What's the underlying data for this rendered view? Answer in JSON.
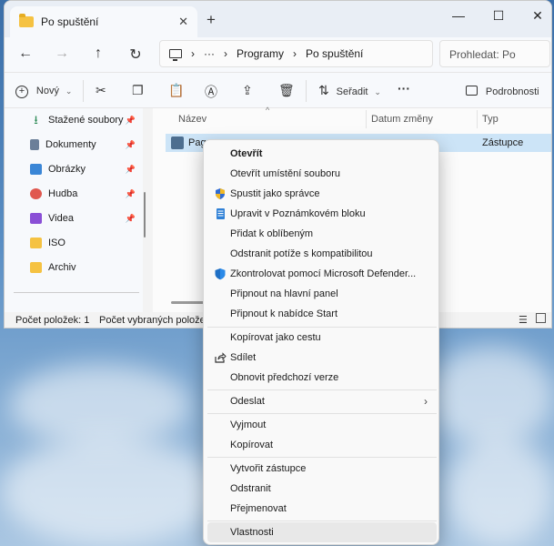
{
  "window": {
    "tab_title": "Po spuštění",
    "tab_close": "✕",
    "new_tab": "+",
    "minimize": "—",
    "maximize": "☐",
    "close": "✕"
  },
  "nav": {
    "back": "←",
    "forward": "→",
    "up": "↑",
    "refresh": "↻",
    "breadcrumb": [
      "›",
      "···",
      "›",
      "Programy",
      "›",
      "Po spuštění"
    ],
    "search_placeholder": "Prohledat: Po"
  },
  "toolbar": {
    "new_label": "Nový",
    "sort_label": "Seřadit",
    "more": "···",
    "details_label": "Podrobnosti"
  },
  "sidebar": {
    "items": [
      {
        "label": "Stažené soubory",
        "icon": "download-icon",
        "pinned": true,
        "color": "#2e8b57"
      },
      {
        "label": "Dokumenty",
        "icon": "documents-icon",
        "pinned": true,
        "color": "#6b7f99"
      },
      {
        "label": "Obrázky",
        "icon": "pictures-icon",
        "pinned": true,
        "color": "#3a86d6"
      },
      {
        "label": "Hudba",
        "icon": "music-icon",
        "pinned": true,
        "color": "#e0584f"
      },
      {
        "label": "Videa",
        "icon": "videos-icon",
        "pinned": true,
        "color": "#8a4fd6"
      },
      {
        "label": "ISO",
        "icon": "folder-icon",
        "pinned": false,
        "color": "#f5c242"
      },
      {
        "label": "Archiv",
        "icon": "folder-icon",
        "pinned": false,
        "color": "#f5c242"
      }
    ]
  },
  "content": {
    "columns": [
      "Název",
      "Datum změny",
      "Typ"
    ],
    "selected_row": {
      "name": "Page",
      "type": "Zástupce"
    }
  },
  "status": {
    "count": "Počet položek: 1",
    "selected": "Počet vybraných položek:"
  },
  "context_menu": {
    "items": [
      {
        "label": "Otevřít",
        "bold": true,
        "icon": ""
      },
      {
        "label": "Otevřít umístění souboru",
        "icon": ""
      },
      {
        "label": "Spustit jako správce",
        "icon": "shield-icon"
      },
      {
        "label": "Upravit v Poznámkovém bloku",
        "icon": "notepad-icon"
      },
      {
        "label": "Přidat k oblíbeným",
        "icon": ""
      },
      {
        "label": "Odstranit potíže s kompatibilitou",
        "icon": ""
      },
      {
        "label": "Zkontrolovat pomocí Microsoft Defender...",
        "icon": "defender-icon"
      },
      {
        "label": "Připnout na hlavní panel",
        "icon": ""
      },
      {
        "label": "Připnout k nabídce Start",
        "icon": ""
      },
      {
        "label": "Kopírovat jako cestu",
        "icon": ""
      },
      {
        "label": "Sdílet",
        "icon": "share-icon"
      },
      {
        "label": "Obnovit předchozí verze",
        "icon": ""
      },
      {
        "label": "Odeslat",
        "icon": "",
        "submenu": "›"
      },
      {
        "label": "Vyjmout",
        "icon": ""
      },
      {
        "label": "Kopírovat",
        "icon": ""
      },
      {
        "label": "Vytvořit zástupce",
        "icon": ""
      },
      {
        "label": "Odstranit",
        "icon": ""
      },
      {
        "label": "Přejmenovat",
        "icon": ""
      },
      {
        "label": "Vlastnosti",
        "icon": ""
      }
    ]
  }
}
